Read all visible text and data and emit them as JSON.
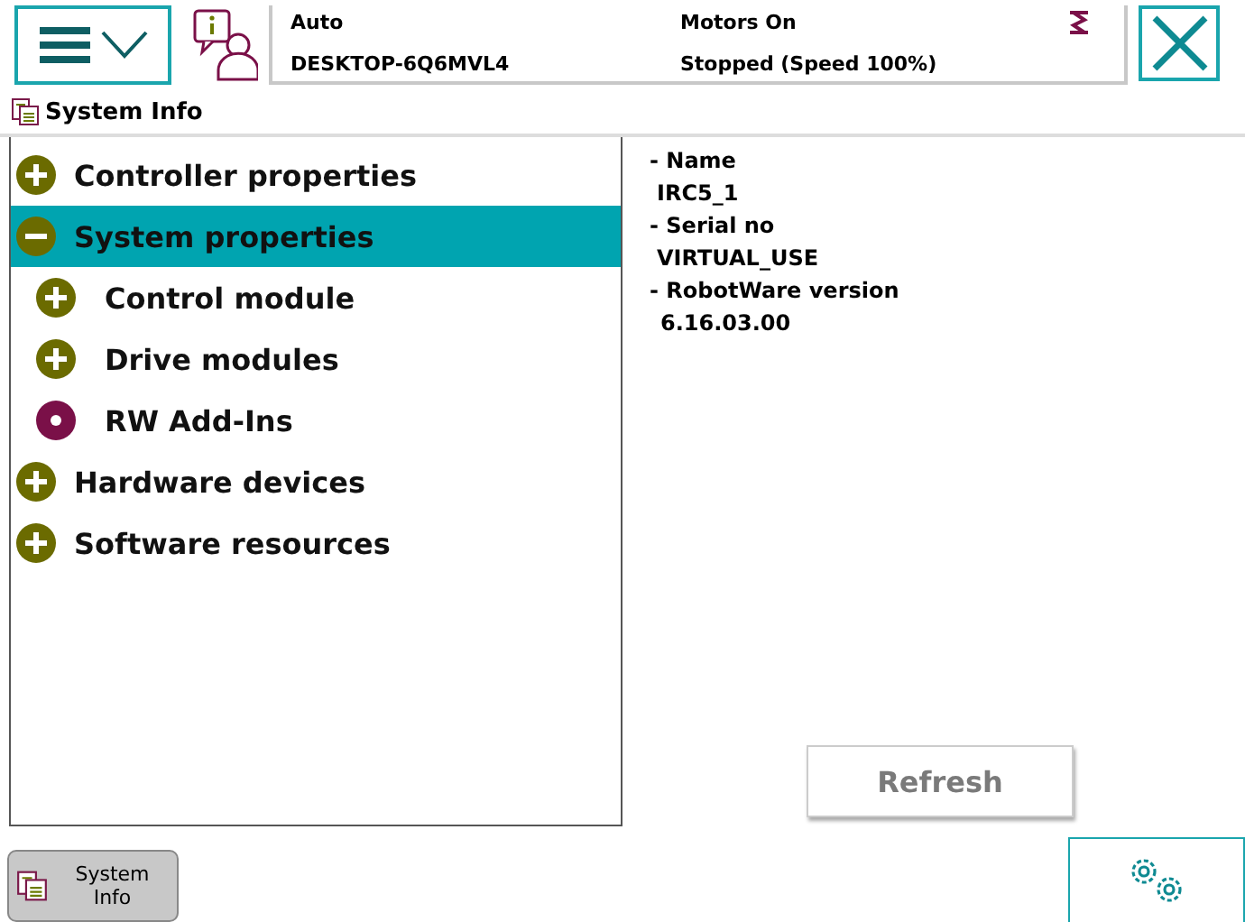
{
  "status_bar": {
    "mode": "Auto",
    "controller": "DESKTOP-6Q6MVL4",
    "motors": "Motors On",
    "state": "Stopped (Speed 100%)"
  },
  "view_title": "System Info",
  "tree": [
    {
      "label": "Controller properties",
      "kind": "expandable",
      "expanded": false,
      "selected": false
    },
    {
      "label": "System properties",
      "kind": "expandable",
      "expanded": true,
      "selected": true,
      "children": [
        {
          "label": "Control module",
          "kind": "expandable",
          "expanded": false,
          "selected": false
        },
        {
          "label": "Drive modules",
          "kind": "expandable",
          "expanded": false,
          "selected": false
        },
        {
          "label": "RW Add-Ins",
          "kind": "leaf",
          "selected": false
        }
      ]
    },
    {
      "label": "Hardware devices",
      "kind": "expandable",
      "expanded": false,
      "selected": false
    },
    {
      "label": "Software resources",
      "kind": "expandable",
      "expanded": false,
      "selected": false
    }
  ],
  "details": [
    {
      "label": "- Name",
      "value": "IRC5_1"
    },
    {
      "label": "- Serial no",
      "value": "VIRTUAL_USE"
    },
    {
      "label": "- RobotWare version",
      "value": "6.16.03.00"
    }
  ],
  "refresh_button": {
    "label": "Refresh",
    "disabled": true
  },
  "taskbar": [
    {
      "label": "System Info",
      "selected": true
    }
  ]
}
